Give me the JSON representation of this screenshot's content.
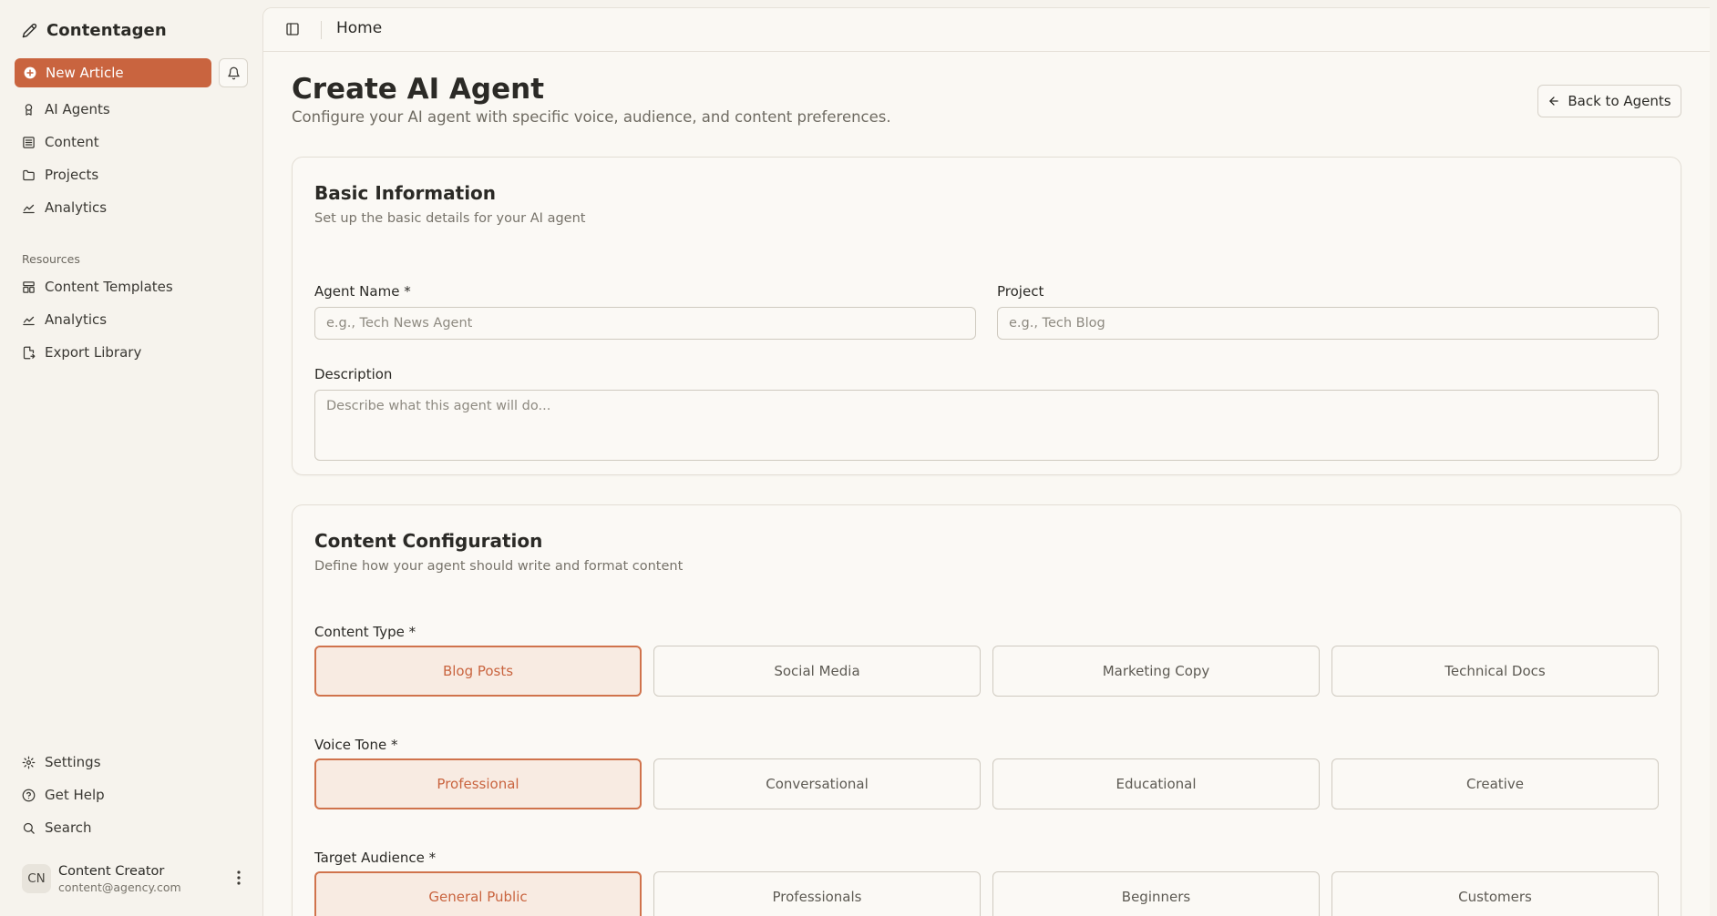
{
  "sidebar": {
    "brand": "Contentagen",
    "new_article": "New Article",
    "nav_items": [
      {
        "label": "AI Agents",
        "icon": "bot-icon"
      },
      {
        "label": "Content",
        "icon": "list-icon"
      },
      {
        "label": "Projects",
        "icon": "folder-icon"
      },
      {
        "label": "Analytics",
        "icon": "chart-icon"
      }
    ],
    "resources_label": "Resources",
    "resource_items": [
      {
        "label": "Content Templates",
        "icon": "template-icon"
      },
      {
        "label": "Analytics",
        "icon": "chart-icon"
      },
      {
        "label": "Export Library",
        "icon": "file-export-icon"
      }
    ],
    "footer_items": [
      {
        "label": "Settings",
        "icon": "gear-icon"
      },
      {
        "label": "Get Help",
        "icon": "help-icon"
      },
      {
        "label": "Search",
        "icon": "search-icon"
      }
    ],
    "user": {
      "initials": "CN",
      "name": "Content Creator",
      "email": "content@agency.com"
    }
  },
  "topbar": {
    "title": "Home"
  },
  "page": {
    "title": "Create AI Agent",
    "subtitle": "Configure your AI agent with specific voice, audience, and content preferences.",
    "back_button": "Back to Agents"
  },
  "basic_info": {
    "title": "Basic Information",
    "description": "Set up the basic details for your AI agent",
    "agent_name_label": "Agent Name *",
    "agent_name_placeholder": "e.g., Tech News Agent",
    "agent_name_value": "",
    "project_label": "Project",
    "project_placeholder": "e.g., Tech Blog",
    "project_value": "",
    "description_label": "Description",
    "description_placeholder": "Describe what this agent will do...",
    "description_value": ""
  },
  "content_config": {
    "title": "Content Configuration",
    "description": "Define how your agent should write and format content",
    "content_type": {
      "label": "Content Type *",
      "options": [
        "Blog Posts",
        "Social Media",
        "Marketing Copy",
        "Technical Docs"
      ],
      "selected": "Blog Posts"
    },
    "voice_tone": {
      "label": "Voice Tone *",
      "options": [
        "Professional",
        "Conversational",
        "Educational",
        "Creative"
      ],
      "selected": "Professional"
    },
    "target_audience": {
      "label": "Target Audience *",
      "options": [
        "General Public",
        "Professionals",
        "Beginners",
        "Customers"
      ],
      "selected": "General Public"
    }
  },
  "colors": {
    "accent": "#c9643f",
    "selected_bg": "#f8ebe2",
    "background": "#f6f3ed"
  }
}
